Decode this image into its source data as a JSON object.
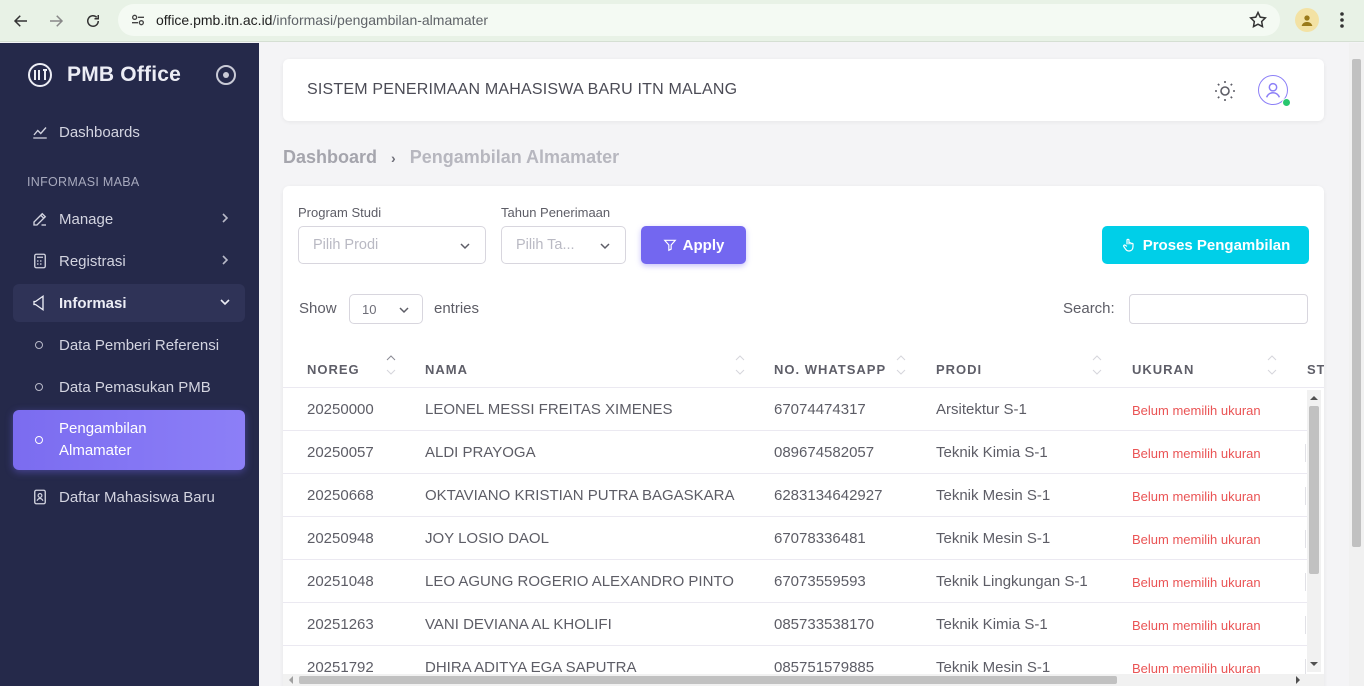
{
  "browser": {
    "url_host": "office.pmb.itn.ac.id",
    "url_path": "/informasi/pengambilan-almamater"
  },
  "sidebar": {
    "brand": "PMB Office",
    "section": "INFORMASI MABA",
    "items": {
      "dashboards": "Dashboards",
      "manage": "Manage",
      "registrasi": "Registrasi",
      "informasi": "Informasi",
      "sub1": "Data Pemberi Referensi",
      "sub2": "Data Pemasukan PMB",
      "sub3_line1": "Pengambilan",
      "sub3_line2": "Almamater",
      "daftar": "Daftar Mahasiswa Baru"
    }
  },
  "header": {
    "title": "SISTEM PENERIMAAN MAHASISWA BARU ITN MALANG"
  },
  "breadcrumb": {
    "root": "Dashboard",
    "current": "Pengambilan Almamater"
  },
  "filters": {
    "prodi_label": "Program Studi",
    "prodi_placeholder": "Pilih Prodi",
    "tahun_label": "Tahun Penerimaan",
    "tahun_placeholder": "Pilih Ta...",
    "apply": "Apply",
    "proses": "Proses Pengambilan"
  },
  "table_controls": {
    "show": "Show",
    "entries_value": "10",
    "entries": "entries",
    "search": "Search:"
  },
  "table": {
    "headers": [
      "NOREG",
      "NAMA",
      "NO. WHATSAPP",
      "PRODI",
      "UKURAN",
      "ST"
    ],
    "rows": [
      [
        "20250000",
        "LEONEL MESSI FREITAS XIMENES",
        "67074474317",
        "Arsitektur S-1",
        "Belum memilih ukuran"
      ],
      [
        "20250057",
        "ALDI PRAYOGA",
        "089674582057",
        "Teknik Kimia S-1",
        "Belum memilih ukuran"
      ],
      [
        "20250668",
        "OKTAVIANO KRISTIAN PUTRA BAGASKARA",
        "6283134642927",
        "Teknik Mesin S-1",
        "Belum memilih ukuran"
      ],
      [
        "20250948",
        "JOY LOSIO DAOL",
        "67078336481",
        "Teknik Mesin S-1",
        "Belum memilih ukuran"
      ],
      [
        "20251048",
        "LEO AGUNG ROGERIO ALEXANDRO PINTO",
        "67073559593",
        "Teknik Lingkungan S-1",
        "Belum memilih ukuran"
      ],
      [
        "20251263",
        "VANI DEVIANA AL KHOLIFI",
        "085733538170",
        "Teknik Kimia S-1",
        "Belum memilih ukuran"
      ],
      [
        "20251792",
        "DHIRA ADITYA EGA SAPUTRA",
        "085751579885",
        "Teknik Mesin S-1",
        "Belum memilih ukuran"
      ]
    ]
  },
  "colors": {
    "sidebar_bg": "#25294a",
    "primary": "#7367f0",
    "info": "#00cfe8",
    "danger": "#ea5455"
  }
}
